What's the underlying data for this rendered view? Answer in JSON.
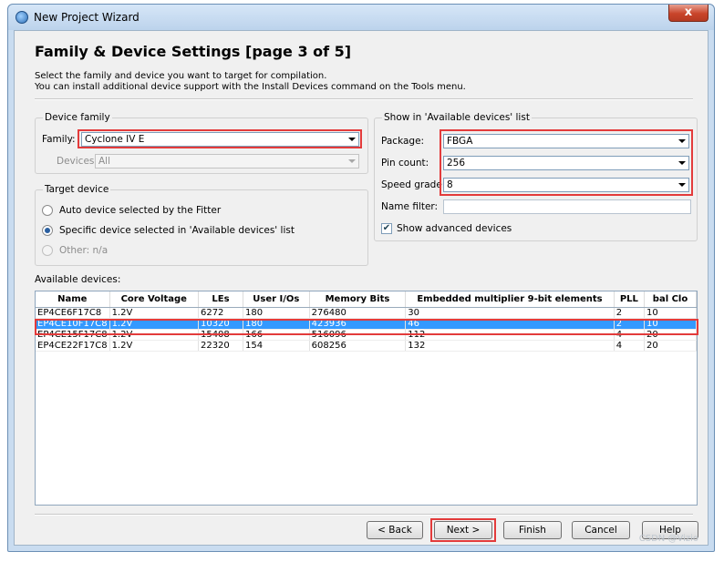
{
  "window": {
    "title": "New Project Wizard",
    "close_label": "x"
  },
  "page": {
    "heading": "Family & Device Settings [page 3 of 5]",
    "description_line1": "Select the family and device you want to target for compilation.",
    "description_line2": "You can install additional device support with the Install Devices command on the Tools menu."
  },
  "device_family": {
    "group_title": "Device family",
    "family_label": "Family:",
    "family_value": "Cyclone IV E",
    "devices_label": "Devices:",
    "devices_value": "All"
  },
  "target_device": {
    "group_title": "Target device",
    "option_auto": "Auto device selected by the Fitter",
    "option_specific": "Specific device selected in 'Available devices' list",
    "option_other": "Other:  n/a"
  },
  "show_filter": {
    "group_title": "Show in 'Available devices' list",
    "package_label": "Package:",
    "package_value": "FBGA",
    "pin_count_label": "Pin count:",
    "pin_count_value": "256",
    "speed_grade_label": "Speed grade:",
    "speed_grade_value": "8",
    "name_filter_label": "Name filter:",
    "name_filter_value": "",
    "show_advanced_label": "Show advanced devices",
    "show_advanced_checked": true
  },
  "available_devices": {
    "label": "Available devices:",
    "columns": [
      "Name",
      "Core Voltage",
      "LEs",
      "User I/Os",
      "Memory Bits",
      "Embedded multiplier 9-bit elements",
      "PLL",
      "bal Clo"
    ],
    "rows": [
      [
        "EP4CE6F17C8",
        "1.2V",
        "6272",
        "180",
        "276480",
        "30",
        "2",
        "10"
      ],
      [
        "EP4CE10F17C8",
        "1.2V",
        "10320",
        "180",
        "423936",
        "46",
        "2",
        "10"
      ],
      [
        "EP4CE15F17C8",
        "1.2V",
        "15408",
        "166",
        "516096",
        "112",
        "4",
        "20"
      ],
      [
        "EP4CE22F17C8",
        "1.2V",
        "22320",
        "154",
        "608256",
        "132",
        "4",
        "20"
      ]
    ],
    "selected_row": 1
  },
  "buttons": {
    "back": "< Back",
    "next": "Next >",
    "finish": "Finish",
    "cancel": "Cancel",
    "help": "Help"
  },
  "watermark": "CSDN @Vizio",
  "colors": {
    "selection": "#3399ff",
    "highlight_box": "#e33b3b"
  }
}
